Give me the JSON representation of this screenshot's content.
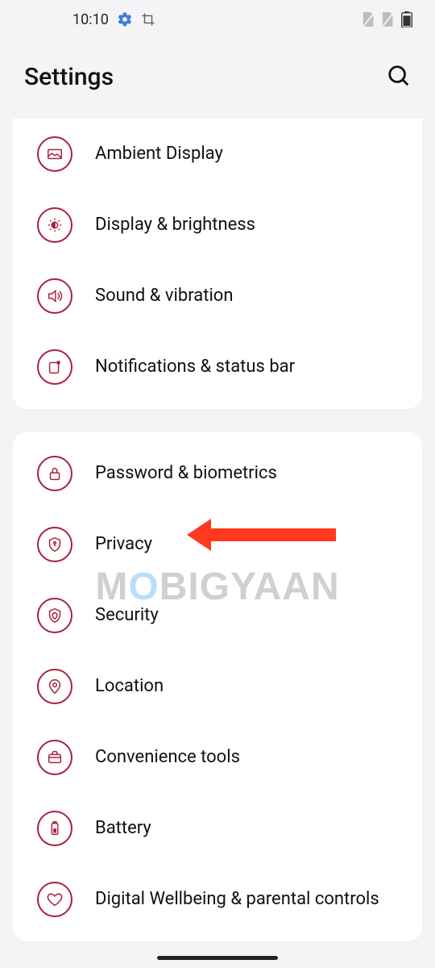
{
  "status_bar": {
    "time": "10:10"
  },
  "header": {
    "title": "Settings"
  },
  "group_a": {
    "items": [
      {
        "label": "Ambient Display"
      },
      {
        "label": "Display & brightness"
      },
      {
        "label": "Sound & vibration"
      },
      {
        "label": "Notifications & status bar"
      }
    ]
  },
  "group_b": {
    "items": [
      {
        "label": "Password & biometrics"
      },
      {
        "label": "Privacy"
      },
      {
        "label": "Security"
      },
      {
        "label": "Location"
      },
      {
        "label": "Convenience tools"
      },
      {
        "label": "Battery"
      },
      {
        "label": "Digital Wellbeing & parental controls"
      }
    ]
  },
  "watermark": {
    "pre": "M",
    "accent": "O",
    "post": "BIGYAAN"
  }
}
